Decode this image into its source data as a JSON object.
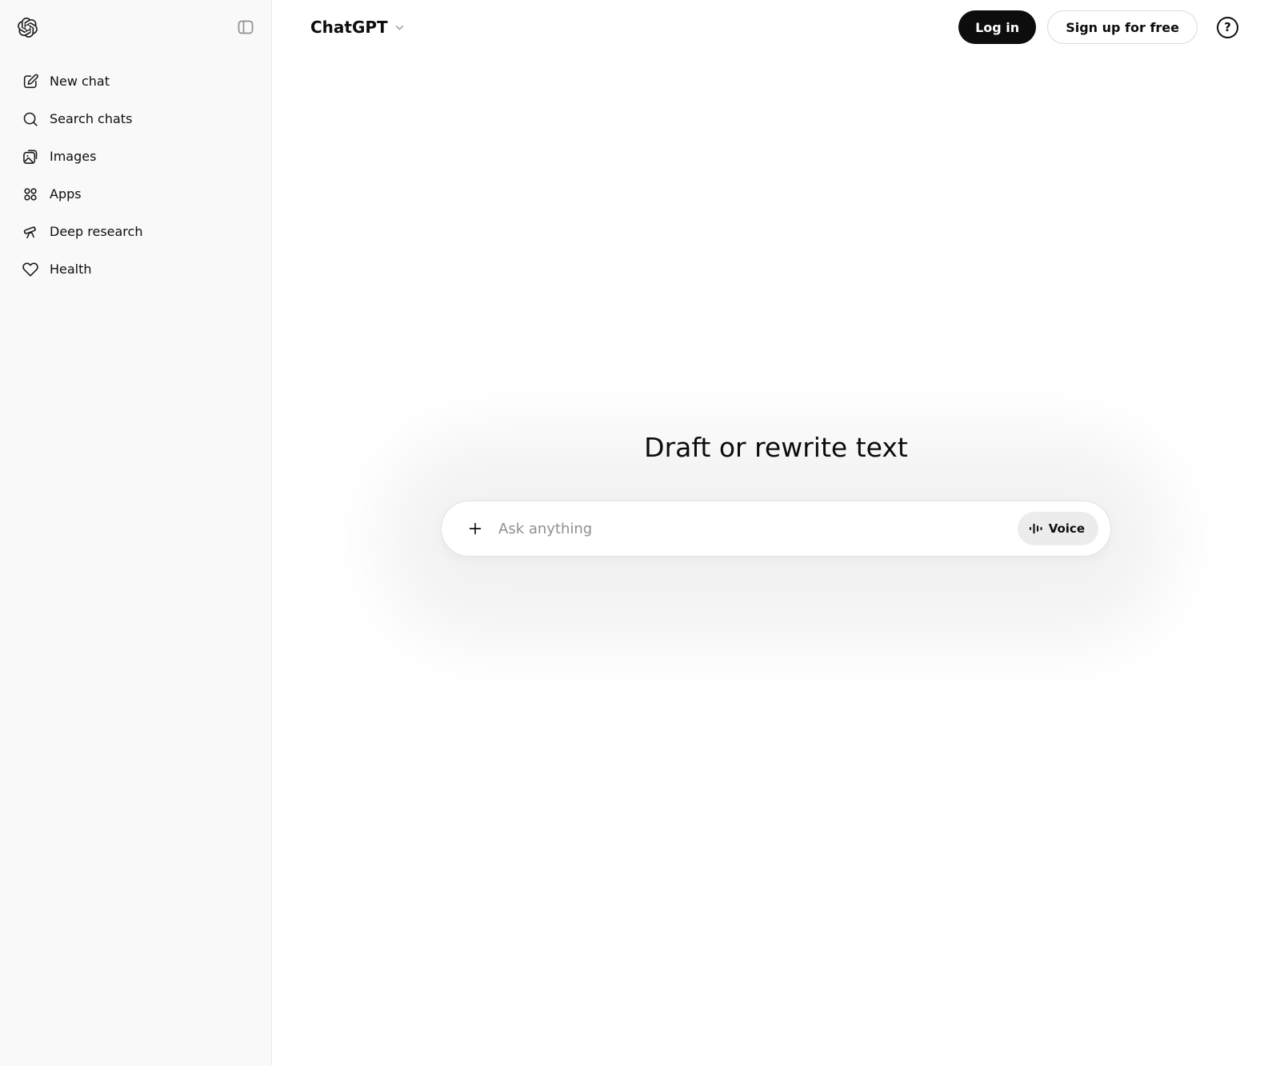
{
  "app": {
    "name": "ChatGPT"
  },
  "sidebar": {
    "items": [
      {
        "label": "New chat",
        "icon": "new-chat-icon"
      },
      {
        "label": "Search chats",
        "icon": "search-icon"
      },
      {
        "label": "Images",
        "icon": "images-icon"
      },
      {
        "label": "Apps",
        "icon": "apps-icon"
      },
      {
        "label": "Deep research",
        "icon": "deep-research-icon"
      },
      {
        "label": "Health",
        "icon": "health-icon"
      }
    ]
  },
  "header": {
    "model_selector_label": "ChatGPT",
    "login_label": "Log in",
    "signup_label": "Sign up for free",
    "help_label": "?"
  },
  "main": {
    "heading": "Draft or rewrite text",
    "composer": {
      "placeholder": "Ask anything",
      "voice_label": "Voice"
    }
  },
  "colors": {
    "sidebar_bg": "#f9f9f9",
    "border": "#ececec",
    "text": "#0d0d0d",
    "placeholder": "#8f8f8f",
    "login_button_bg": "#0d0d0d",
    "voice_button_bg": "#ececec"
  }
}
